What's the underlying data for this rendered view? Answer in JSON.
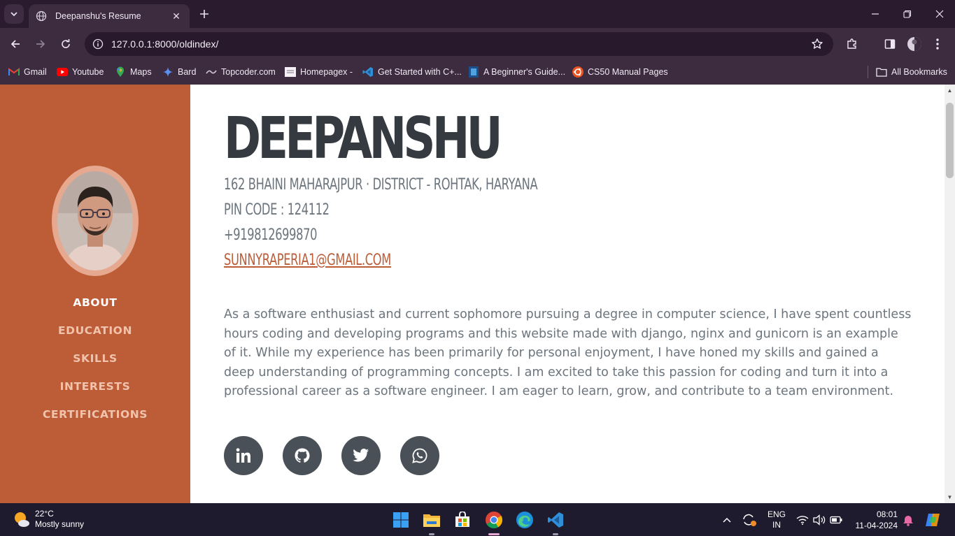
{
  "browser": {
    "tab_title": "Deepanshu's Resume",
    "url": "127.0.0.1:8000/oldindex/",
    "bookmarks": [
      {
        "label": "Gmail",
        "icon": "gmail-icon"
      },
      {
        "label": "Youtube",
        "icon": "youtube-icon"
      },
      {
        "label": "Maps",
        "icon": "maps-icon"
      },
      {
        "label": "Bard",
        "icon": "bard-icon"
      },
      {
        "label": "Topcoder.com",
        "icon": "topcoder-icon"
      },
      {
        "label": "Homepagex -",
        "icon": "page-icon"
      },
      {
        "label": "Get Started with C+...",
        "icon": "vscode-icon"
      },
      {
        "label": "A Beginner's Guide...",
        "icon": "guide-icon"
      },
      {
        "label": "CS50 Manual Pages",
        "icon": "ubuntu-icon"
      }
    ],
    "all_bookmarks": "All Bookmarks"
  },
  "resume": {
    "name": "DEEPANSHU",
    "address_line": "162 BHAINI MAHARAJPUR · DISTRICT - ROHTAK, HARYANA",
    "pin_line": "PIN CODE : 124112",
    "phone": "+919812699870",
    "email": "SUNNYRAPERIA1@GMAIL.COM",
    "about": "As a software enthusiast and current sophomore pursuing a degree in computer science, I have spent countless hours coding and developing programs and this website made with django, nginx and gunicorn is an example of it. While my experience has been primarily for personal enjoyment, I have honed my skills and gained a deep understanding of programming concepts. I am excited to take this passion for coding and turn it into a professional career as a software engineer. I am eager to learn, grow, and contribute to a team environment."
  },
  "nav": {
    "items": [
      {
        "label": "ABOUT",
        "active": true
      },
      {
        "label": "EDUCATION",
        "active": false
      },
      {
        "label": "SKILLS",
        "active": false
      },
      {
        "label": "INTERESTS",
        "active": false
      },
      {
        "label": "CERTIFICATIONS",
        "active": false
      }
    ]
  },
  "socials": [
    "linkedin-icon",
    "github-icon",
    "twitter-icon",
    "whatsapp-icon"
  ],
  "colors": {
    "sidebar": "#bd5d38",
    "heading": "#343a40",
    "muted": "#6c757d",
    "social_bg": "#495057"
  },
  "taskbar": {
    "temperature": "22°C",
    "weather": "Mostly sunny",
    "lang_top": "ENG",
    "lang_bottom": "IN",
    "time": "08:01",
    "date": "11-04-2024"
  }
}
